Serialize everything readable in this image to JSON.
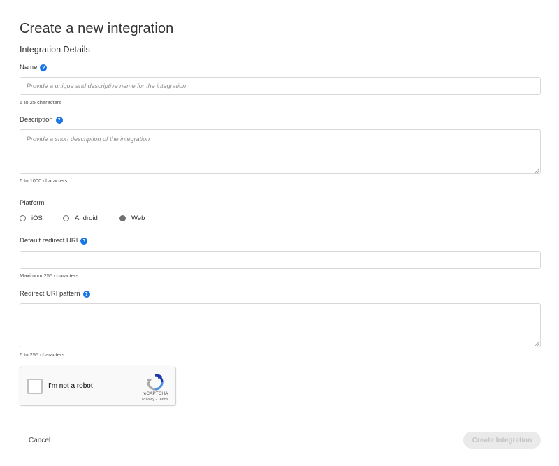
{
  "page": {
    "title": "Create a new integration",
    "section_title": "Integration Details"
  },
  "form": {
    "name": {
      "label": "Name",
      "placeholder": "Provide a unique and descriptive name for the integration",
      "value": "",
      "hint": "6 to 25 characters",
      "icon": "help-icon"
    },
    "description": {
      "label": "Description",
      "placeholder": "Provide a short description of the integration",
      "value": "",
      "hint": "6 to 1000 characters",
      "icon": "help-icon"
    },
    "platform": {
      "label": "Platform",
      "options": [
        "iOS",
        "Android",
        "Web"
      ],
      "selected": "Web"
    },
    "default_redirect_uri": {
      "label": "Default redirect URI",
      "placeholder": "",
      "value": "",
      "hint": "Maximum 255 characters",
      "icon": "help-icon"
    },
    "redirect_uri_pattern": {
      "label": "Redirect URI pattern",
      "placeholder": "",
      "value": "",
      "hint": "6 to 255 characters",
      "icon": "help-icon"
    }
  },
  "recaptcha": {
    "label": "I'm not a robot",
    "brand": "reCAPTCHA",
    "links": "Privacy - Terms"
  },
  "actions": {
    "cancel_label": "Cancel",
    "create_label": "Create Integration"
  },
  "colors": {
    "help_icon": "#1473e6",
    "create_button_disabled_bg": "#eaeaea",
    "create_button_disabled_text": "#c4c4c4"
  }
}
